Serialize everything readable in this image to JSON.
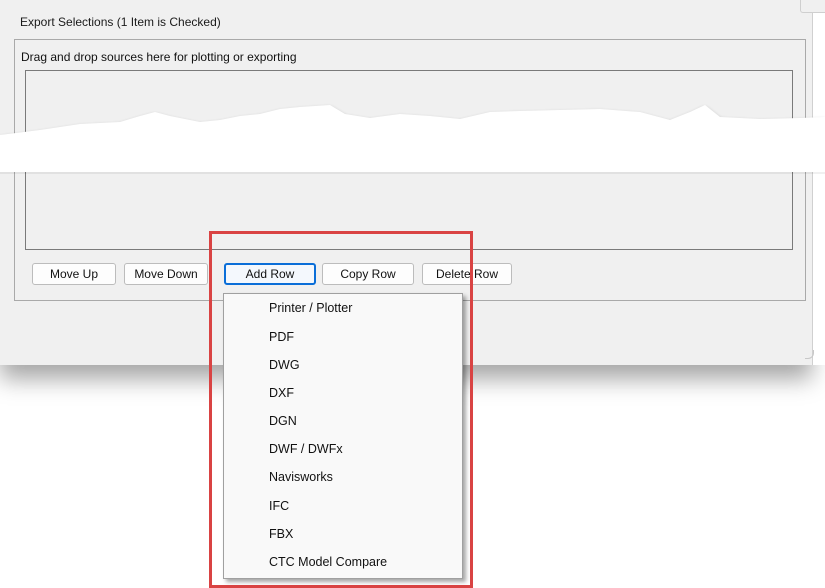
{
  "dialog": {
    "group_title": "Export Selections (1 Item is Checked)",
    "hint": "Drag and drop sources here for plotting or exporting"
  },
  "buttons": {
    "move_up": "Move Up",
    "move_down": "Move Down",
    "add_row": "Add Row",
    "copy_row": "Copy Row",
    "delete_row": "Delete Row"
  },
  "add_row_menu": {
    "items": [
      "Printer / Plotter",
      "PDF",
      "DWG",
      "DXF",
      "DGN",
      "DWF / DWFx",
      "Navisworks",
      "IFC",
      "FBX",
      "CTC Model Compare"
    ]
  },
  "colors": {
    "window_bg": "#f0f0f0",
    "highlight_box": "#d94343",
    "focus_border": "#0a6ed8"
  }
}
